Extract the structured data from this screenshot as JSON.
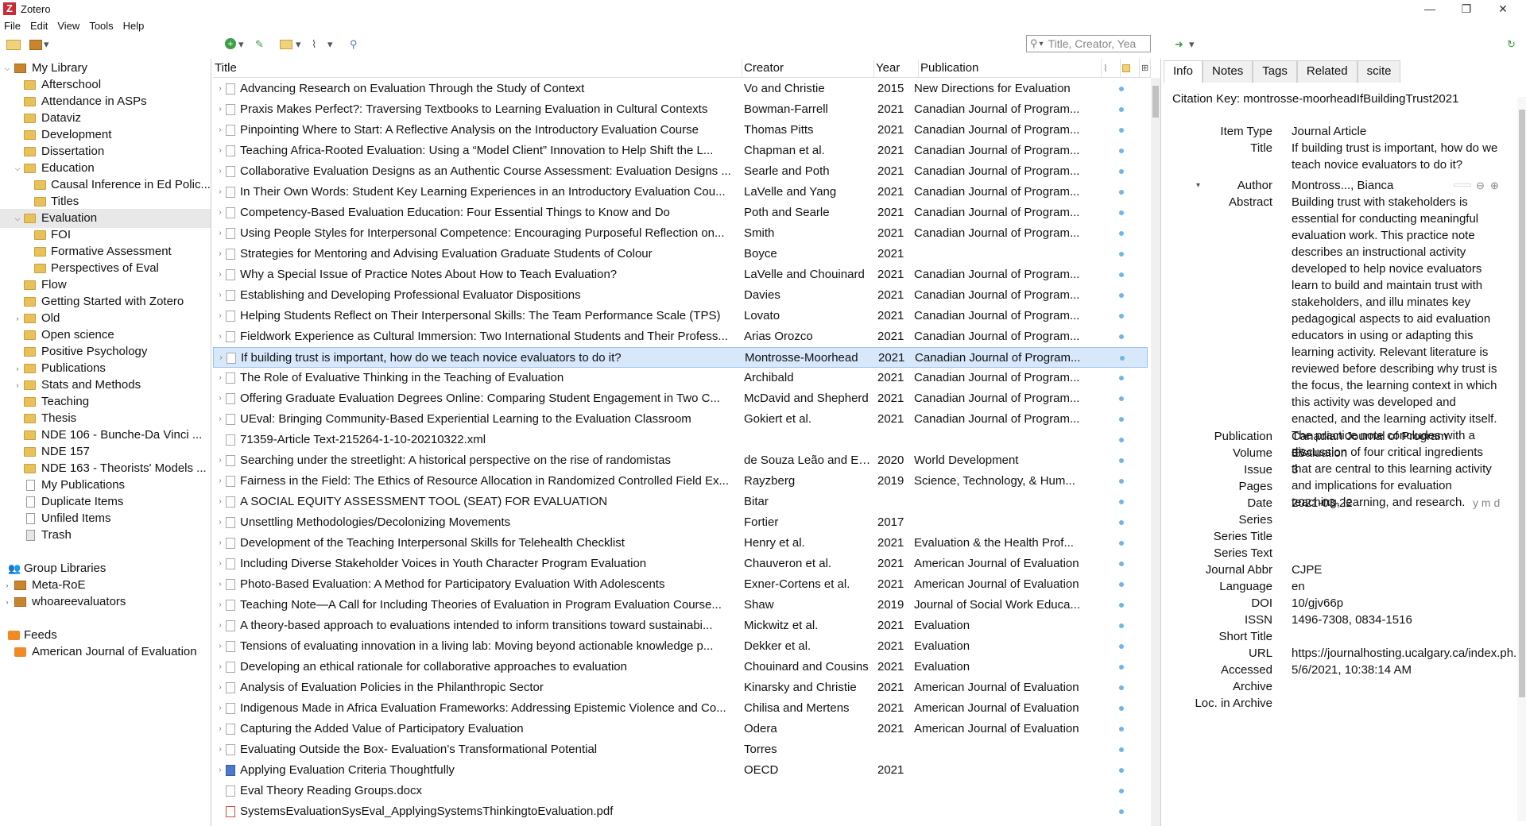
{
  "app": {
    "title": "Zotero",
    "logo_letter": "Z",
    "brand_color": "#cc2936"
  },
  "window_controls": {
    "minimize": "—",
    "maximize": "❐",
    "close": "✕"
  },
  "menu": [
    "File",
    "Edit",
    "View",
    "Tools",
    "Help"
  ],
  "search": {
    "placeholder": "Title, Creator, Yea"
  },
  "collections": [
    {
      "label": "My Library",
      "type": "library"
    },
    {
      "label": "Afterschool",
      "type": "folder"
    },
    {
      "label": "Attendance in ASPs",
      "type": "folder"
    },
    {
      "label": "Dataviz",
      "type": "folder"
    },
    {
      "label": "Development",
      "type": "folder"
    },
    {
      "label": "Dissertation",
      "type": "folder"
    },
    {
      "label": "Education",
      "type": "folder"
    },
    {
      "label": "Causal Inference in Ed Polic...",
      "type": "folder"
    },
    {
      "label": "Titles",
      "type": "folder"
    },
    {
      "label": "Evaluation",
      "type": "folder"
    },
    {
      "label": "FOI",
      "type": "folder"
    },
    {
      "label": "Formative Assessment",
      "type": "folder"
    },
    {
      "label": "Perspectives of Eval",
      "type": "folder"
    },
    {
      "label": "Flow",
      "type": "folder"
    },
    {
      "label": "Getting Started with Zotero",
      "type": "folder"
    },
    {
      "label": "Old",
      "type": "folder"
    },
    {
      "label": "Open science",
      "type": "folder"
    },
    {
      "label": "Positive Psychology",
      "type": "folder"
    },
    {
      "label": "Publications",
      "type": "folder"
    },
    {
      "label": "Stats and Methods",
      "type": "folder"
    },
    {
      "label": "Teaching",
      "type": "folder"
    },
    {
      "label": "Thesis",
      "type": "folder"
    },
    {
      "label": "NDE 106 - Bunche-Da Vinci ...",
      "type": "folder"
    },
    {
      "label": "NDE 157",
      "type": "folder"
    },
    {
      "label": "NDE 163 - Theorists' Models ...",
      "type": "folder"
    },
    {
      "label": "My Publications",
      "type": "doc"
    },
    {
      "label": "Duplicate Items",
      "type": "doc"
    },
    {
      "label": "Unfiled Items",
      "type": "doc"
    },
    {
      "label": "Trash",
      "type": "trash"
    },
    {
      "label": "Group Libraries",
      "type": "group"
    },
    {
      "label": "Meta-RoE",
      "type": "library"
    },
    {
      "label": "whoareevaluators",
      "type": "library"
    },
    {
      "label": "Feeds",
      "type": "feed"
    },
    {
      "label": "American Journal of Evaluation",
      "type": "rss"
    }
  ],
  "columns": {
    "title": "Title",
    "creator": "Creator",
    "year": "Year",
    "publication": "Publication"
  },
  "items": [
    {
      "title": "Advancing Research on Evaluation Through the Study of Context",
      "creator": "Vo and Christie",
      "year": "2015",
      "publication": "New Directions for Evaluation"
    },
    {
      "title": "Praxis Makes Perfect?: Traversing Textbooks to Learning Evaluation in Cultural Contexts",
      "creator": "Bowman-Farrell",
      "year": "2021",
      "publication": "Canadian Journal of Program..."
    },
    {
      "title": "Pinpointing Where to Start: A Reflective Analysis on the Introductory Evaluation Course",
      "creator": "Thomas Pitts",
      "year": "2021",
      "publication": "Canadian Journal of Program..."
    },
    {
      "title": "Teaching Africa-Rooted Evaluation: Using a “Model Client” Innovation to Help Shift the L...",
      "creator": "Chapman et al.",
      "year": "2021",
      "publication": "Canadian Journal of Program..."
    },
    {
      "title": "Collaborative Evaluation Designs as an Authentic Course Assessment: Evaluation Designs ...",
      "creator": "Searle and Poth",
      "year": "2021",
      "publication": "Canadian Journal of Program..."
    },
    {
      "title": "In Their Own Words: Student Key Learning Experiences in an Introductory Evaluation Cou...",
      "creator": "LaVelle and Yang",
      "year": "2021",
      "publication": "Canadian Journal of Program..."
    },
    {
      "title": "Competency-Based Evaluation Education: Four Essential Things to Know and Do",
      "creator": "Poth and Searle",
      "year": "2021",
      "publication": "Canadian Journal of Program..."
    },
    {
      "title": "Using People Styles for Interpersonal Competence: Encouraging Purposeful Reflection on...",
      "creator": "Smith",
      "year": "2021",
      "publication": "Canadian Journal of Program..."
    },
    {
      "title": "Strategies for Mentoring and Advising Evaluation Graduate Students of Colour",
      "creator": "Boyce",
      "year": "2021",
      "publication": ""
    },
    {
      "title": "Why a Special Issue of Practice Notes About How to Teach Evaluation?",
      "creator": "LaVelle and Chouinard",
      "year": "2021",
      "publication": "Canadian Journal of Program..."
    },
    {
      "title": "Establishing and Developing Professional Evaluator Dispositions",
      "creator": "Davies",
      "year": "2021",
      "publication": "Canadian Journal of Program..."
    },
    {
      "title": "Helping Students Reflect on Their Interpersonal Skills: The Team Performance Scale (TPS)",
      "creator": "Lovato",
      "year": "2021",
      "publication": "Canadian Journal of Program..."
    },
    {
      "title": "Fieldwork Experience as Cultural Immersion: Two International Students and Their Profess...",
      "creator": "Arias Orozco",
      "year": "2021",
      "publication": "Canadian Journal of Program..."
    },
    {
      "title": "If building trust is important, how do we teach novice evaluators to do it?",
      "creator": "Montrosse-Moorhead",
      "year": "2021",
      "publication": "Canadian Journal of Program...",
      "selected": true
    },
    {
      "title": "The Role of Evaluative Thinking in the Teaching of Evaluation",
      "creator": "Archibald",
      "year": "2021",
      "publication": "Canadian Journal of Program..."
    },
    {
      "title": "Offering Graduate Evaluation Degrees Online: Comparing Student Engagement in Two C...",
      "creator": "McDavid and Shepherd",
      "year": "2021",
      "publication": "Canadian Journal of Program..."
    },
    {
      "title": "UEval: Bringing Community-Based Experiential Learning to the Evaluation Classroom",
      "creator": "Gokiert et al.",
      "year": "2021",
      "publication": "Canadian Journal of Program..."
    },
    {
      "title": "71359-Article Text-215264-1-10-20210322.xml",
      "creator": "",
      "year": "",
      "publication": "",
      "notwisty": true
    },
    {
      "title": "Searching under the streetlight: A historical perspective on the rise of randomistas",
      "creator": "de Souza Leão and Eyal",
      "year": "2020",
      "publication": "World Development"
    },
    {
      "title": "Fairness in the Field: The Ethics of Resource Allocation in Randomized Controlled Field Ex...",
      "creator": "Rayzberg",
      "year": "2019",
      "publication": "Science, Technology, & Hum..."
    },
    {
      "title": "A SOCIAL EQUITY ASSESSMENT TOOL (SEAT) FOR EVALUATION",
      "creator": "Bitar",
      "year": "",
      "publication": ""
    },
    {
      "title": "Unsettling Methodologies/Decolonizing Movements",
      "creator": "Fortier",
      "year": "2017",
      "publication": ""
    },
    {
      "title": "Development of the Teaching Interpersonal Skills for Telehealth Checklist",
      "creator": "Henry et al.",
      "year": "2021",
      "publication": "Evaluation & the Health Prof..."
    },
    {
      "title": "Including Diverse Stakeholder Voices in Youth Character Program Evaluation",
      "creator": "Chauveron et al.",
      "year": "2021",
      "publication": "American Journal of Evaluation"
    },
    {
      "title": "Photo-Based Evaluation: A Method for Participatory Evaluation With Adolescents",
      "creator": "Exner-Cortens et al.",
      "year": "2021",
      "publication": "American Journal of Evaluation"
    },
    {
      "title": "Teaching Note—A Call for Including Theories of Evaluation in Program Evaluation Course...",
      "creator": "Shaw",
      "year": "2019",
      "publication": "Journal of Social Work Educa..."
    },
    {
      "title": "A theory-based approach to evaluations intended to inform transitions toward sustainabi...",
      "creator": "Mickwitz et al.",
      "year": "2021",
      "publication": "Evaluation"
    },
    {
      "title": "Tensions of evaluating innovation in a living lab: Moving beyond actionable knowledge p...",
      "creator": "Dekker et al.",
      "year": "2021",
      "publication": "Evaluation"
    },
    {
      "title": "Developing an ethical rationale for collaborative approaches to evaluation",
      "creator": "Chouinard and Cousins",
      "year": "2021",
      "publication": "Evaluation"
    },
    {
      "title": "Analysis of Evaluation Policies in the Philanthropic Sector",
      "creator": "Kinarsky and Christie",
      "year": "2021",
      "publication": "American Journal of Evaluation"
    },
    {
      "title": "Indigenous Made in Africa Evaluation Frameworks: Addressing Epistemic Violence and Co...",
      "creator": "Chilisa and Mertens",
      "year": "2021",
      "publication": "American Journal of Evaluation"
    },
    {
      "title": "Capturing the Added Value of Participatory Evaluation",
      "creator": "Odera",
      "year": "2021",
      "publication": "American Journal of Evaluation"
    },
    {
      "title": "Evaluating Outside the Box- Evaluation’s Transformational Potential",
      "creator": "Torres",
      "year": "",
      "publication": ""
    },
    {
      "title": "Applying Evaluation Criteria Thoughtfully",
      "creator": "OECD",
      "year": "2021",
      "publication": "",
      "icon": "blue"
    },
    {
      "title": "Eval Theory Reading Groups.docx",
      "creator": "",
      "year": "",
      "publication": "",
      "notwisty": true
    },
    {
      "title": "SystemsEvaluationSysEval_ApplyingSystemsThinkingtoEvaluation.pdf",
      "creator": "",
      "year": "",
      "publication": "",
      "notwisty": true,
      "icon": "pdf"
    }
  ],
  "tabs": [
    "Info",
    "Notes",
    "Tags",
    "Related",
    "scite"
  ],
  "citation_key": "Citation Key: montrosse-moorheadIfBuildingTrust2021",
  "info": {
    "item_type_label": "Item Type",
    "item_type": "Journal Article",
    "title_label": "Title",
    "title": "If building trust is important, how do we teach novice evaluators to do it?",
    "author_label": "Author",
    "author": "Montross..., Bianca",
    "abstract_label": "Abstract",
    "abstract": "Building trust with stakeholders is essential for conducting meaningful evaluation work. This practice note describes an instructional activity developed to help novice evaluators learn to build and maintain trust with stakeholders, and illu minates key pedagogical aspects to aid evaluation educators in using or adapting this learning activity. Relevant literature is reviewed before describing why trust is the focus, the learning context in which this activity was developed and enacted, and the learning activity itself. The practice note concludes with a discussion of four critical ingredients that are central to this learning activity and implications for evaluation teaching, learning, and research.",
    "publication_label": "Publication",
    "publication": "Canadian Journal of Program Evaluation",
    "volume_label": "Volume",
    "volume": "35",
    "issue_label": "Issue",
    "issue": "3",
    "pages_label": "Pages",
    "pages": "",
    "date_label": "Date",
    "date": "2021-03-22",
    "date_format": "y m d",
    "series_label": "Series",
    "series": "",
    "series_title_label": "Series Title",
    "series_title": "",
    "series_text_label": "Series Text",
    "series_text": "",
    "journal_abbr_label": "Journal Abbr",
    "journal_abbr": "CJPE",
    "language_label": "Language",
    "language": "en",
    "doi_label": "DOI",
    "doi": "10/gjv66p",
    "issn_label": "ISSN",
    "issn": "1496-7308, 0834-1516",
    "short_title_label": "Short Title",
    "short_title": "",
    "url_label": "URL",
    "url": "https://journalhosting.ucalgary.ca/index.ph...",
    "accessed_label": "Accessed",
    "accessed": "5/6/2021, 10:38:14 AM",
    "archive_label": "Archive",
    "archive": "",
    "loc_archive_label": "Loc. in Archive",
    "loc_archive": ""
  }
}
